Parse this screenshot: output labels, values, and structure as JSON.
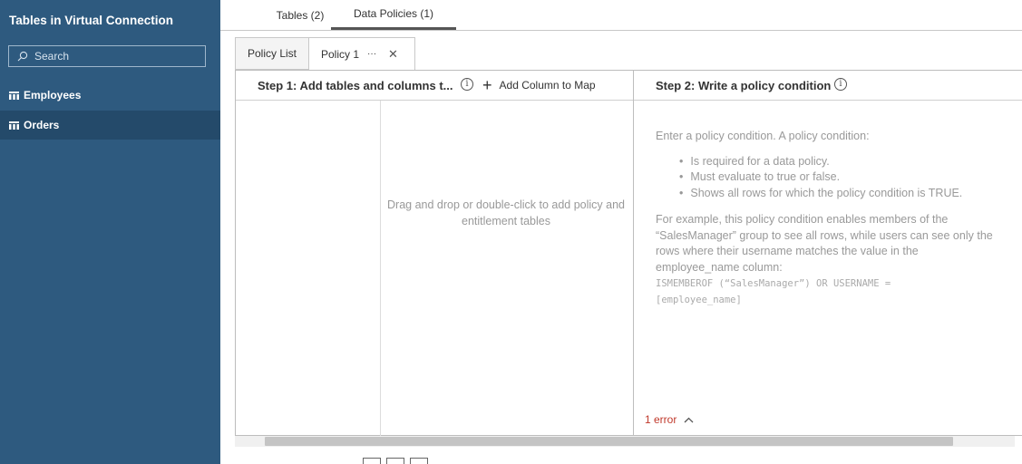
{
  "sidebar": {
    "title": "Tables in Virtual Connection",
    "search_placeholder": "Search",
    "items": [
      {
        "label": "Employees",
        "icon": "table-icon"
      },
      {
        "label": "Orders",
        "icon": "table-icon"
      }
    ]
  },
  "top_tabs": [
    {
      "label": "Tables (2)"
    },
    {
      "label": "Data Policies (1)"
    }
  ],
  "policy_tabs": {
    "list_label": "Policy List",
    "policy_label": "Policy 1",
    "more_label": "···",
    "close_label": "✕"
  },
  "step1": {
    "title": "Step 1: Add tables and columns t...",
    "info": "i",
    "add_column_plus": "+",
    "add_column_label": "Add Column to Map",
    "drop_hint": "Drag and drop or double-click to add policy and entitlement tables"
  },
  "step2": {
    "title": "Step 2: Write a policy condition",
    "info": "i",
    "intro": "Enter a policy condition. A policy condition:",
    "bullets": [
      "Is required for a data policy.",
      "Must evaluate to true or false.",
      "Shows all rows for which the policy condition is TRUE."
    ],
    "example_lines": [
      "For example, this policy condition enables members of the",
      "“SalesManager” group to see all rows, while users can see only the",
      "rows where their username matches the value in the",
      "employee_name column:"
    ],
    "code": "ISMEMBEROF (“SalesManager”) OR USERNAME = [employee_name]"
  },
  "error": {
    "label": "1 error",
    "chevron": "^"
  },
  "colors": {
    "sidebar_bg": "#2e5a7f",
    "sidebar_selected": "#244a6a",
    "error": "#c0392b"
  }
}
